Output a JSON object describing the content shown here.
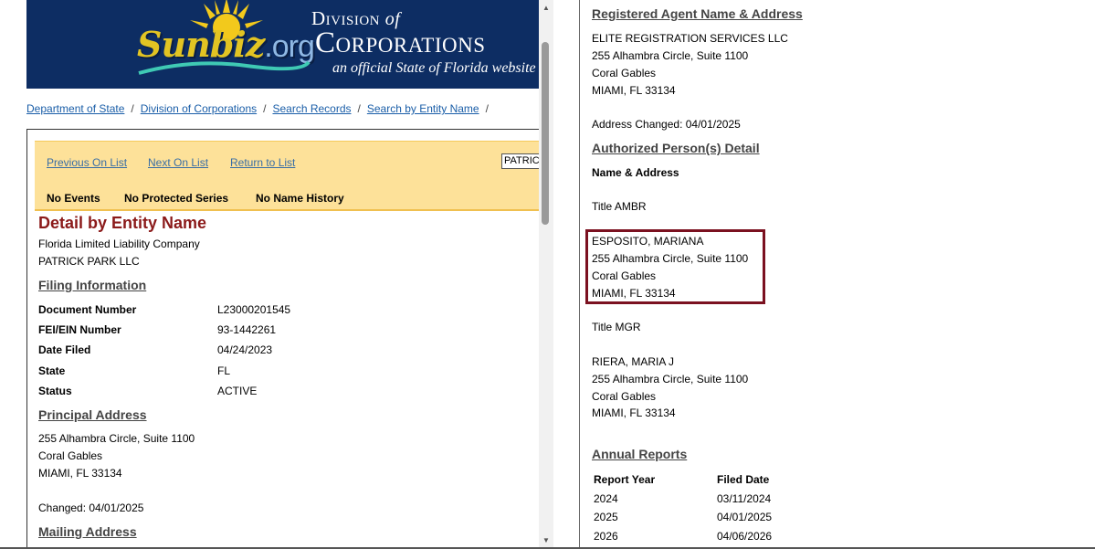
{
  "banner": {
    "logo_main": "Sunbiz",
    "logo_tld": ".org",
    "division_of": "Division",
    "division_of_italic": "of",
    "corporations": "Corporations",
    "subtitle": "an official State of Florida website"
  },
  "breadcrumb": [
    "Department of State",
    "Division of Corporations",
    "Search Records",
    "Search by Entity Name"
  ],
  "breadcrumb_sep": "/",
  "nav": {
    "previous": "Previous On List",
    "next": "Next On List",
    "return": "Return to List",
    "search_value": "PATRIC",
    "no_events": "No Events",
    "no_protected": "No Protected Series",
    "no_name_history": "No Name History"
  },
  "detail": {
    "title": "Detail by Entity Name",
    "entity_type": "Florida Limited Liability Company",
    "entity_name": "PATRICK PARK LLC"
  },
  "filing": {
    "heading": "Filing Information",
    "fields": [
      {
        "label": "Document Number",
        "value": "L23000201545"
      },
      {
        "label": "FEI/EIN Number",
        "value": "93-1442261"
      },
      {
        "label": "Date Filed",
        "value": "04/24/2023"
      },
      {
        "label": "State",
        "value": "FL"
      },
      {
        "label": "Status",
        "value": "ACTIVE"
      }
    ]
  },
  "principal": {
    "heading": "Principal Address",
    "line1": "255 Alhambra Circle, Suite 1100",
    "line2": "Coral Gables",
    "line3": "MIAMI, FL 33134",
    "changed": "Changed: 04/01/2025"
  },
  "mailing": {
    "heading": "Mailing Address"
  },
  "agent": {
    "heading": "Registered Agent Name & Address",
    "name": "ELITE REGISTRATION SERVICES LLC",
    "line1": "255 Alhambra Circle, Suite 1100",
    "line2": "Coral Gables",
    "line3": "MIAMI, FL 33134",
    "changed": "Address Changed: 04/01/2025"
  },
  "authorized": {
    "heading": "Authorized Person(s) Detail",
    "subheading": "Name & Address",
    "persons": [
      {
        "title": "Title AMBR",
        "name": "ESPOSITO, MARIANA",
        "line1": "255 Alhambra Circle, Suite 1100",
        "line2": "Coral Gables",
        "line3": "MIAMI, FL 33134"
      },
      {
        "title": "Title MGR",
        "name": "RIERA, MARIA J",
        "line1": "255 Alhambra Circle, Suite 1100",
        "line2": "Coral Gables",
        "line3": "MIAMI, FL 33134"
      }
    ]
  },
  "annual": {
    "heading": "Annual Reports",
    "col_year": "Report Year",
    "col_date": "Filed Date",
    "rows": [
      {
        "year": "2024",
        "date": "03/11/2024"
      },
      {
        "year": "2025",
        "date": "04/01/2025"
      },
      {
        "year": "2026",
        "date": "04/06/2026"
      }
    ]
  },
  "colors": {
    "banner": "#0d2d63",
    "nav_bar": "#fde199",
    "title": "#8b1a1a",
    "link": "#1a5ea8",
    "highlight": "#7b1120"
  },
  "icons": {
    "scroll_up": "scroll-up-arrow-icon",
    "scroll_down": "scroll-down-arrow-icon",
    "sun": "sun-logo-icon"
  }
}
